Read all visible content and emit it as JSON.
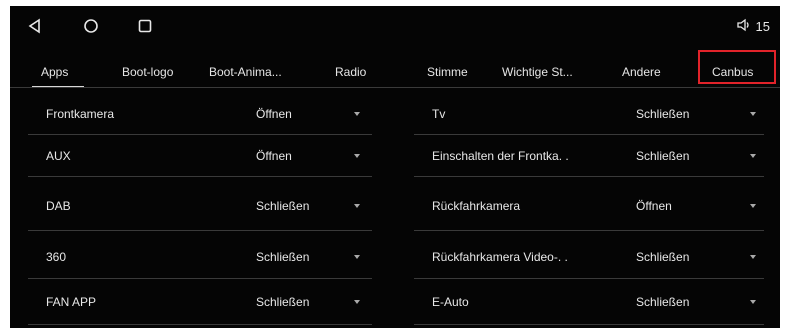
{
  "status": {
    "volume_value": "15"
  },
  "tabs": [
    {
      "label": "Apps"
    },
    {
      "label": "Boot-logo"
    },
    {
      "label": "Boot-Anima..."
    },
    {
      "label": "Radio"
    },
    {
      "label": "Stimme"
    },
    {
      "label": "Wichtige St..."
    },
    {
      "label": "Andere"
    },
    {
      "label": "Canbus"
    }
  ],
  "left_rows": [
    {
      "label": "Frontkamera",
      "value": "Öffnen"
    },
    {
      "label": "AUX",
      "value": "Öffnen"
    },
    {
      "label": "DAB",
      "value": "Schließen"
    },
    {
      "label": "360",
      "value": "Schließen"
    },
    {
      "label": "FAN APP",
      "value": "Schließen"
    }
  ],
  "right_rows": [
    {
      "label": "Tv",
      "value": "Schließen"
    },
    {
      "label": "Einschalten der Frontka. .",
      "value": "Schließen"
    },
    {
      "label": "Rückfahrkamera",
      "value": "Öffnen"
    },
    {
      "label": "Rückfahrkamera Video-. .",
      "value": "Schließen"
    },
    {
      "label": "E-Auto",
      "value": "Schließen"
    }
  ],
  "colors": {
    "background": "#050505",
    "text": "#e8e8e8",
    "highlight": "#e2232a",
    "divider": "#3a3a3a"
  },
  "icons": [
    "back-icon",
    "home-icon",
    "recent-apps-icon",
    "volume-icon",
    "dropdown-arrow-icon"
  ]
}
